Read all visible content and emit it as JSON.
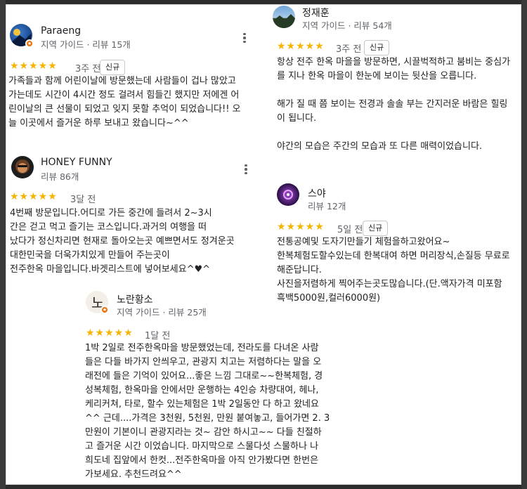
{
  "reviews": [
    {
      "name": "Paraeng",
      "meta": "지역 가이드 · 리뷰 15개",
      "stars": "★★★★★",
      "date": "3주 전",
      "tag": "신규",
      "text": "가족들과 함께 어린이날에 방문했는데 사람들이 겁나 많았고\n가는데도 시간이 4시간 정도 걸려서 힘들긴 했지만 저에겐 어\n린이날의 큰 선물이 되었고 잊지 못할 추억이 되었습니다!! 오\n늘 이곳에서 즐거운 하루 보내고 왔습니다~^^"
    },
    {
      "name": "HONEY FUNNY",
      "meta": "리뷰 86개",
      "stars": "★★★★★",
      "date": "3달 전",
      "text": "4번째 방문입니다.어디로 가든 중간에 들려서 2~3시\n간은 걷고 먹고 즐기는 코스입니다.과거의 여행을 떠\n났다가 정신차리면 현재로 돌아오는곳 예쁘면서도 정겨운곳\n대한민국을 더욱가치있게 만들어 주는곳이\n전주한옥 마을입니다.바겟리스트에 넣어보세요^♥^"
    },
    {
      "name": "노란황소",
      "meta": "지역 가이드 · 리뷰 25개",
      "stars": "★★★★★",
      "date": "1달 전",
      "text": "1박 2일로 전주한옥마을 방문했었는데, 전라도를 다녀온 사람\n들은 다들 바가지 안씌우고, 관광지 치고는 저렴하다는 말을 오\n래전에 들은 기억이 있어요...좋은 느낌 그대로~~한복체험, 경\n성복체험, 한옥마을 안에서만 운행하는 4인승 차량대여, 헤나,\n케리커쳐, 타로, 할수 있는체험은 1박 2일동안 다 하고 왔네요\n^^ 근데....가격은 3천원, 5천원, 만원 붙여놓고, 들어가면 2. 3\n만원이 기본이니 관광지라는 것~ 감안 하시고~~ 다들 친절하\n고 즐거운 시간 이었습니다. 마지막으로 스물다섯 스물하나 나\n희도네 집앞에서 한컷...전주한옥마을 아직 안가봤다면 한번은\n가보세요. 추천드려요^^"
    },
    {
      "name": "정재훈",
      "meta": "지역 가이드 · 리뷰 54개",
      "stars": "★★★★★",
      "date": "3주 전",
      "tag": "신규",
      "text": "항상 전주 한옥 마을을 방문하면, 시끌벅적하고 붐비는 중심가\n를 지나 한옥 마을이 한눈에 보이는 뒷산을 오릅니다.\n\n해가 질 때 쯤 보이는 전경과 솔솔 부는 간지러운 바람은 힐링\n이 됩니다.\n\n야간의 모습은 주간의 모습과 또 다른 매력이었습니다."
    },
    {
      "name": "스야",
      "meta": "리뷰 12개",
      "stars": "★★★★★",
      "date": "5일 전",
      "tag": "신규",
      "text": "전통공예및 도자기만들기 체험을하고왔어요~\n한복체험도할수있는데 한복대여 하면 머리장식,손질등 무료로\n해준답니다.\n사진을저렴하게 찍어주는곳도많습니다.(단.액자가격 미포함\n흑백5000원,컬러6000원)"
    }
  ],
  "colors": {
    "star": "#f4b400",
    "badge": "#e8710a"
  }
}
